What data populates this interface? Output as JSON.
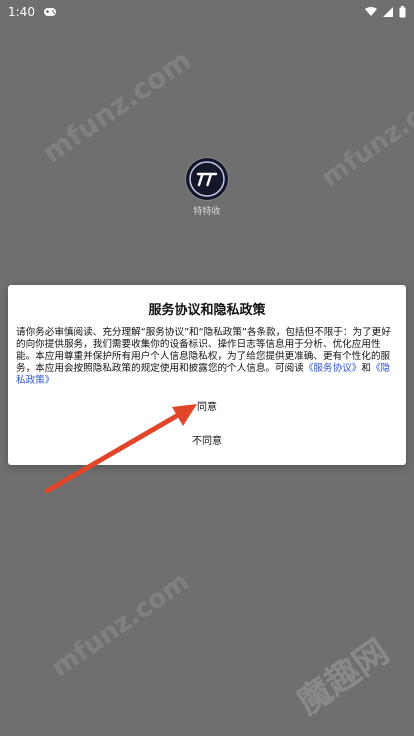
{
  "status_bar": {
    "time": "1:40",
    "icons": [
      "gamepad-icon",
      "wifi-icon",
      "cellular-icon",
      "battery-icon"
    ]
  },
  "watermark": {
    "text": "mfunz.com",
    "logo_text": "魔趣网"
  },
  "app": {
    "name": "特特收",
    "icon": "app-logo-icon"
  },
  "dialog": {
    "title": "服务协议和隐私政策",
    "body_intro": "请你务必审慎阅读、充分理解“服务协议”和“隐私政策”各条款，包括但不限于：为了更好的向你提供服务，我们需要收集你的设备标识、操作日志等信息用于分析、优化应用性能。本应用尊重并保护所有用户个人信息隐私权，为了给您提供更准确、更有个性化的服务，本应用会按照隐私政策的规定使用和披露您的个人信息。可阅读",
    "service_link": "《服务协议》",
    "and_text": "和",
    "privacy_link": "《隐私政策》",
    "agree_label": "同意",
    "disagree_label": "不同意"
  },
  "colors": {
    "overlay": "#6f6f6f",
    "link": "#2f54d0",
    "arrow": "#e2462a"
  }
}
